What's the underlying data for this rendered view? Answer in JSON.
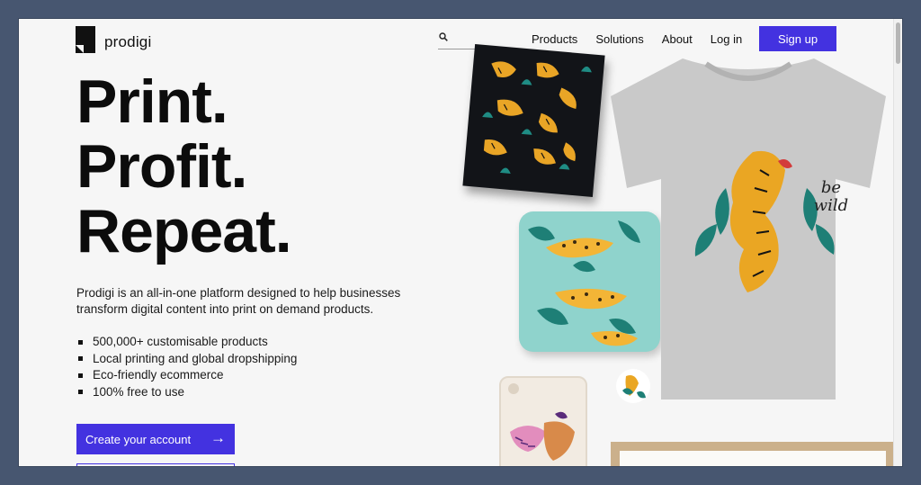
{
  "brand": {
    "name": "prodigi"
  },
  "search": {
    "placeholder": ""
  },
  "nav": {
    "items": [
      "Products",
      "Solutions",
      "About",
      "Log in"
    ],
    "signup_label": "Sign up"
  },
  "hero": {
    "headline": [
      "Print.",
      "Profit.",
      "Repeat."
    ],
    "intro": "Prodigi is an all-in-one platform designed to help businesses transform digital content into print on demand products.",
    "bullets": [
      "500,000+ customisable products",
      "Local printing and global dropshipping",
      "Eco-friendly ecommerce",
      "100% free to use"
    ],
    "cta_label": "Create your account",
    "cta_arrow": "→"
  },
  "products": {
    "tshirt_text": "be wild"
  },
  "colors": {
    "accent": "#4332e0",
    "background": "#f6f6f6",
    "frame": "#475670"
  },
  "icons": {
    "search": "search-icon",
    "arrow": "arrow-right-icon"
  }
}
